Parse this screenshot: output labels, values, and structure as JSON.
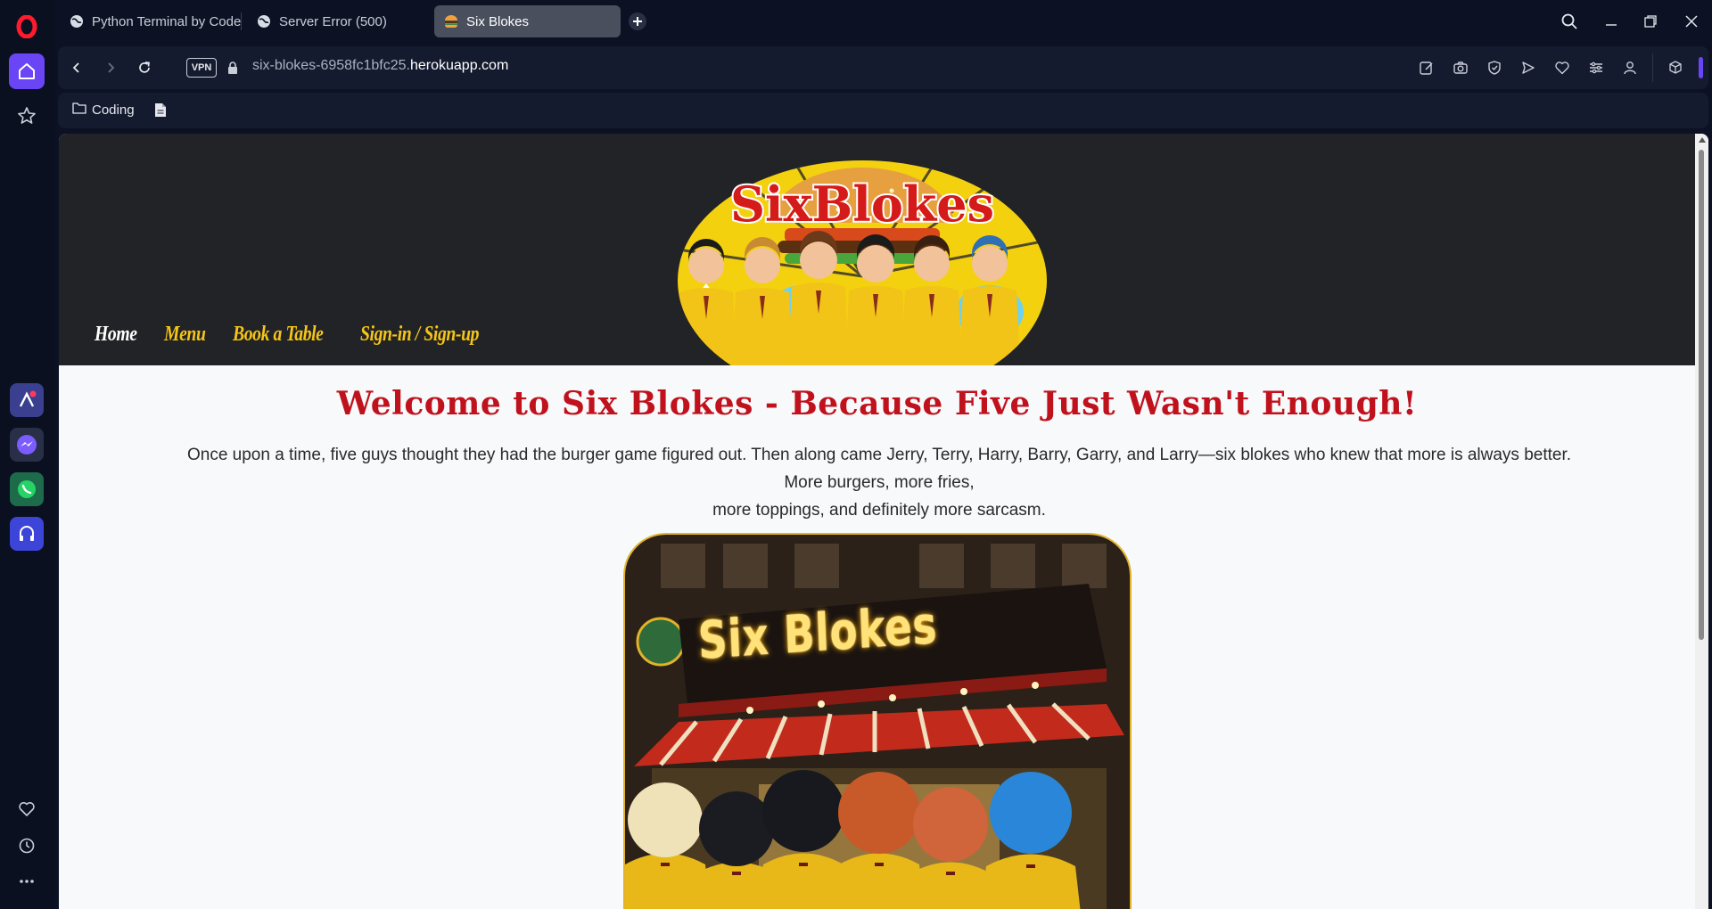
{
  "browser": {
    "tabs": [
      {
        "title": "Python Terminal by Code",
        "icon": "globe-icon"
      },
      {
        "title": "Server Error (500)",
        "icon": "globe-icon"
      },
      {
        "title": "Six Blokes",
        "icon": "burger-icon",
        "active": true
      }
    ],
    "url": {
      "prefix": "six-blokes-6958fc1bfc25.",
      "host": "herokuapp.com"
    },
    "vpn_label": "VPN",
    "bookmarks": [
      {
        "label": "Coding",
        "icon": "folder-icon"
      }
    ]
  },
  "site": {
    "logo_text": "SixBlokes",
    "nav": {
      "home": "Home",
      "menu": "Menu",
      "book": "Book a Table",
      "signin": "Sign-in / Sign-up"
    },
    "welcome": "Welcome to Six Blokes - Because Five Just Wasn't Enough!",
    "intro_line1": "Once upon a time, five guys thought they had the burger game figured out. Then along came Jerry, Terry, Harry, Barry, Garry, and Larry—six blokes who knew that more is always better. More burgers, more fries,",
    "intro_line2": "more toppings, and definitely more sarcasm.",
    "hero_sign": "Six Blokes"
  },
  "colors": {
    "accent_red": "#c0121d",
    "nav_yellow": "#f5c518",
    "header_dark": "#222326",
    "browser_dark": "#0c1224"
  }
}
